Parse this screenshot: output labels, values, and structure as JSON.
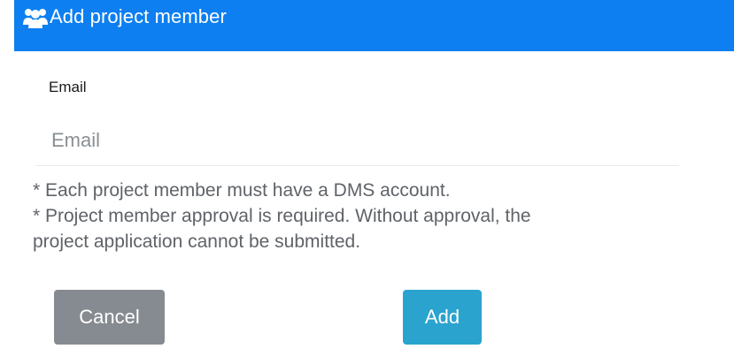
{
  "dialog": {
    "title": "Add project member",
    "title_icon": "users-icon",
    "header_color": "#0d7ff0"
  },
  "form": {
    "email_label": "Email",
    "email_value": "",
    "email_placeholder": "Email"
  },
  "notes": [
    "* Each project member must have a DMS account.",
    "* Project member approval is required. Without approval, the",
    "project application cannot be submitted."
  ],
  "buttons": {
    "cancel_label": "Cancel",
    "cancel_color": "#868b91",
    "add_label": "Add",
    "add_color": "#2aa3cf"
  }
}
